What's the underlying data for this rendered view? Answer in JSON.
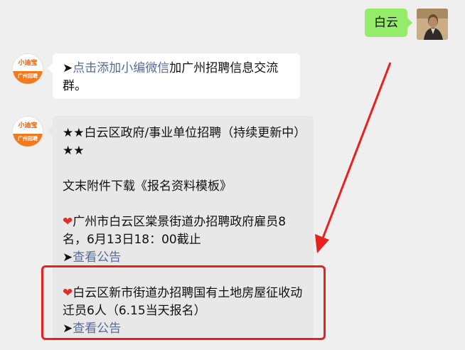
{
  "user_message": {
    "text": "白云",
    "bubble_color": "#95ec69"
  },
  "bot": {
    "avatar_brand": "小迪宝",
    "avatar_caption": "广州招聘",
    "accent_color": "#f07a1c"
  },
  "message_1": {
    "prefix": "➤",
    "link_text": "点击添加小编微信",
    "suffix": "加广州招聘信息交流群。"
  },
  "message_2": {
    "heading": "★★白云区政府/事业单位招聘（持续更新中）★★",
    "attachment_note": "文末附件下载《报名资料模板》",
    "items": [
      {
        "text": "广州市白云区棠景街道办招聘政府雇员8名，6月13日18：00截止",
        "link_text": "查看公告"
      },
      {
        "text": "白云区新市街道办招聘国有土地房屋征收动迁员6人（6.15当天报名）",
        "link_text": "查看公告"
      }
    ]
  },
  "colors": {
    "link": "#576b95",
    "annotation_red": "#e8211f",
    "heart": "#e02e24"
  }
}
